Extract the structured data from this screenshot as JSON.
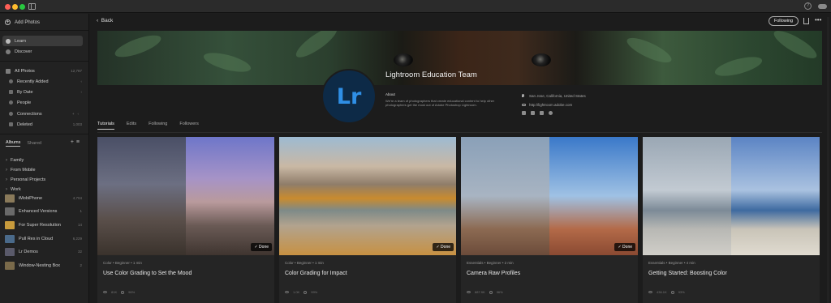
{
  "sidebar": {
    "add_photos": "Add Photos",
    "learn": "Learn",
    "discover": "Discover",
    "all_photos": {
      "label": "All Photos",
      "count": "12,787"
    },
    "library": [
      {
        "label": "Recently Added",
        "icon": "clock-icon"
      },
      {
        "label": "By Date",
        "icon": "calendar-icon"
      },
      {
        "label": "People",
        "icon": "person-icon"
      },
      {
        "label": "Connections",
        "icon": "link-icon"
      },
      {
        "label": "Deleted",
        "icon": "trash-icon",
        "count": "1,003"
      }
    ],
    "tabs": {
      "albums": "Albums",
      "shared": "Shared"
    },
    "folders": [
      "Family",
      "From Mobile",
      "Personal Projects",
      "Work"
    ],
    "albums": [
      {
        "label": "iMobiPhone",
        "count": "4,704",
        "color": "#8a7a5a"
      },
      {
        "label": "Enhanced Versions",
        "count": "1",
        "color": "#6a6a6a"
      },
      {
        "label": "For Super Resolution",
        "count": "14",
        "color": "#c79a3c"
      },
      {
        "label": "Pull Res in Cloud",
        "count": "6,229",
        "color": "#4a6a8a"
      },
      {
        "label": "Lr Demos",
        "count": "32",
        "color": "#5a5a6a"
      },
      {
        "label": "Window-Nesting Box",
        "count": "2",
        "color": "#7a6a4a"
      }
    ]
  },
  "header": {
    "back": "Back",
    "following": "Following"
  },
  "profile": {
    "logo": "Lr",
    "name": "Lightroom Education Team",
    "about_heading": "About",
    "about_text": "We're a team of photographers that create educational content to help other photographers get the most out of Adobe Photoshop Lightroom.",
    "location": "San Jose, California, United States",
    "url": "http://lightroom.adobe.com",
    "accent": "#2f8fe6"
  },
  "profile_tabs": [
    "Tutorials",
    "Edits",
    "Following",
    "Followers"
  ],
  "cards": [
    {
      "meta": "Color • Beginner • 1 min",
      "title": "Use Color Grading to Set the Mood",
      "views": "81K",
      "rating": "96%",
      "done": "Done"
    },
    {
      "meta": "Color • Beginner • 1 min",
      "title": "Color Grading for Impact",
      "views": "1.0K",
      "rating": "99%",
      "done": "Done"
    },
    {
      "meta": "Essentials • Beginner • 2 min",
      "title": "Camera Raw Profiles",
      "views": "887.9K",
      "rating": "96%",
      "done": "Done"
    },
    {
      "meta": "Essentials • Beginner • 4 min",
      "title": "Getting Started: Boosting Color",
      "views": "436.1K",
      "rating": "93%",
      "done": "Done"
    }
  ]
}
